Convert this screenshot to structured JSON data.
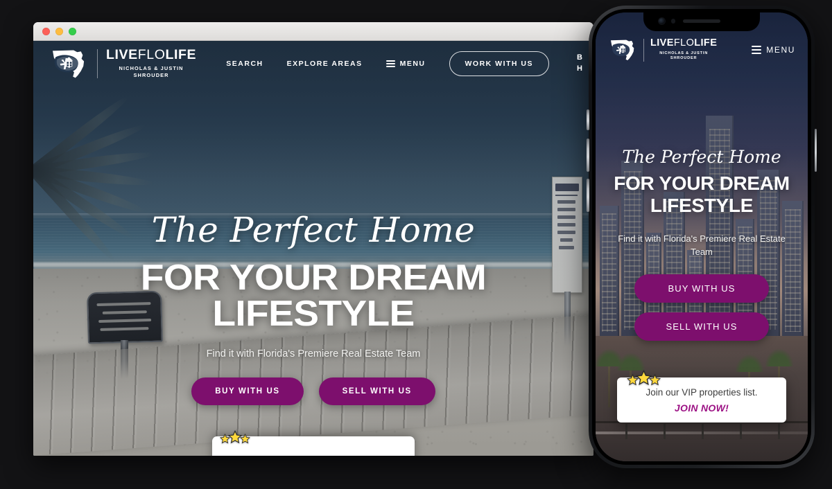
{
  "brand": {
    "name_live": "LIVE",
    "name_flo": "FLO",
    "name_life": "LIFE",
    "full_name": "LIVEFLOLIFE",
    "agents_line1": "NICHOLAS & JUSTIN",
    "agents_line2": "SHROUDER",
    "accent_color": "#7d0f6d",
    "nav_color": "#ffffff"
  },
  "desktop": {
    "window_controls": [
      "close",
      "minimize",
      "zoom"
    ],
    "nav": {
      "search": "SEARCH",
      "explore_areas": "EXPLORE AREAS",
      "menu": "MENU",
      "work_with_us": "WORK WITH US",
      "clipped_right_line1": "B",
      "clipped_right_line2": "H"
    },
    "hero": {
      "script_line": "The Perfect Home",
      "headline": "FOR YOUR DREAM LIFESTYLE",
      "subtitle": "Find it with Florida's Premiere Real Estate Team",
      "buy_button": "BUY WITH US",
      "sell_button": "SELL WITH US"
    },
    "scene": {
      "description": "beach with boardwalk, palm frond, reserved-beach sign and private property sign",
      "left_sign_text": "This Area of Beach Reserved for Club Members & Resort Guests Only",
      "right_sign_text": "PRIVATE — NO TRESPASSING / NO SWIMMING"
    }
  },
  "phone": {
    "nav": {
      "menu": "MENU"
    },
    "hero": {
      "script_line": "The Perfect Home",
      "headline_line1": "FOR YOUR DREAM",
      "headline_line2": "LIFESTYLE",
      "subtitle": "Find it with Florida's Premiere Real Estate Team",
      "buy_button": "BUY WITH US",
      "sell_button": "SELL WITH US"
    },
    "popup": {
      "text": "Join our VIP properties list.",
      "link": "JOIN NOW!",
      "star_count": 3
    },
    "scene": {
      "description": "Tampa downtown skyline at dusk with palms and roadway"
    }
  }
}
